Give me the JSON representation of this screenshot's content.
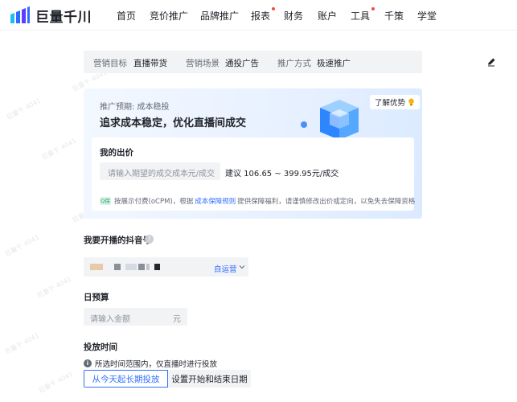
{
  "brand": {
    "name": "巨量千川",
    "colors": [
      "#1bc0f0",
      "#2e6bff",
      "#5b3dff"
    ]
  },
  "nav": {
    "items": [
      {
        "label": "首页",
        "dot": false
      },
      {
        "label": "竞价推广",
        "dot": false
      },
      {
        "label": "品牌推广",
        "dot": false
      },
      {
        "label": "报表",
        "dot": true
      },
      {
        "label": "财务",
        "dot": false
      },
      {
        "label": "账户",
        "dot": false
      },
      {
        "label": "工具",
        "dot": true
      },
      {
        "label": "千策",
        "dot": false
      },
      {
        "label": "学堂",
        "dot": false
      }
    ]
  },
  "summary": {
    "goal_label": "营销目标",
    "goal_value": "直播带货",
    "scene_label": "营销场景",
    "scene_value": "通投广告",
    "method_label": "推广方式",
    "method_value": "极速推广",
    "edit_icon": "pencil-icon"
  },
  "promo": {
    "subtitle": "推广预期: 成本稳投",
    "title": "追求成本稳定，优化直播间成交",
    "learn_more": "了解优势",
    "bid": {
      "title": "我的出价",
      "placeholder": "请输入期望的成交成本",
      "unit": "元/成交",
      "suggest": "建议 106.65 ~ 399.95元/成交",
      "badge": "Q保",
      "note_prefix": "按展示付费(oCPM)，根据",
      "note_link": "成本保障规则",
      "note_suffix": "提供保障福利，请谨慎修改出价或定向，以免失去保障资格"
    }
  },
  "account": {
    "label": "我要开播的抖音号",
    "tag": "自运营"
  },
  "budget": {
    "label": "日预算",
    "placeholder": "请输入金额",
    "unit": "元"
  },
  "schedule": {
    "label": "投放时间",
    "hint": "所选时间范围内，仅直播时进行投放",
    "option_active": "从今天起长期投放",
    "option_other": "设置开始和结束日期"
  },
  "watermark": "巨量千 4041",
  "colors": {
    "accent": "#3370ff",
    "dot": "#f54a45",
    "input_bg": "#f2f3f5"
  }
}
